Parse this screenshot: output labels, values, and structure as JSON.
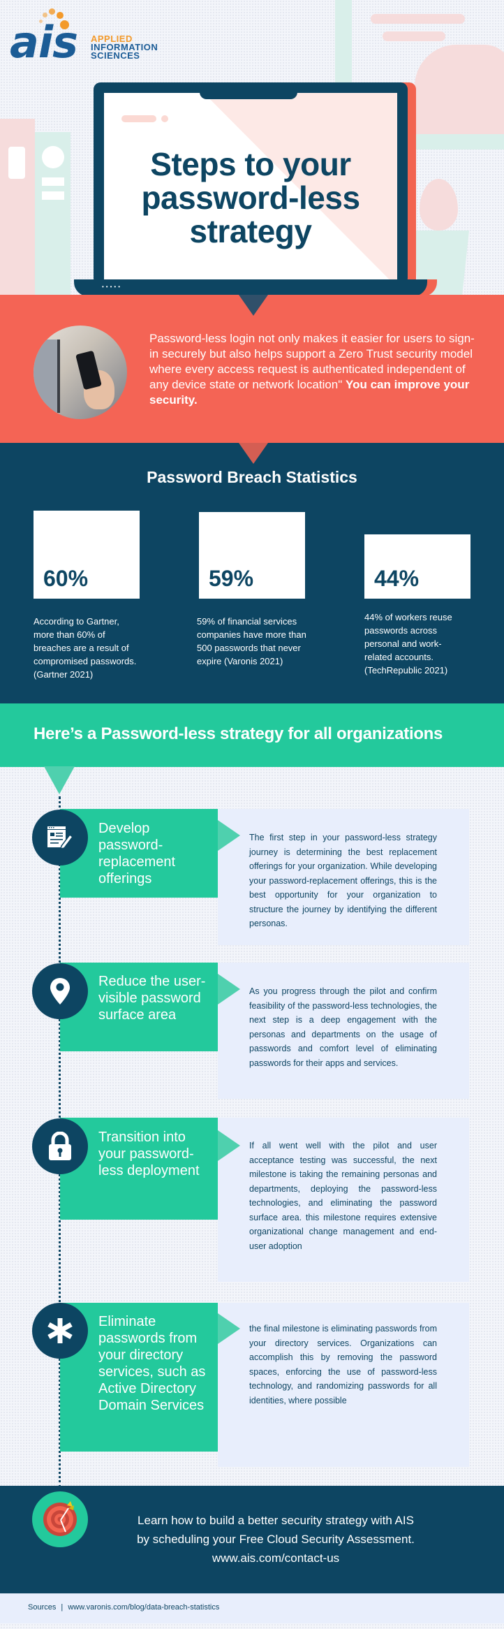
{
  "logo": {
    "mark": "ais",
    "line1": "APPLIED",
    "line2": "INFORMATION",
    "line3": "SCIENCES",
    "colors": {
      "orange": "#f39a2b",
      "blue": "#1b5c96"
    }
  },
  "hero": {
    "title_line1": "Steps to your",
    "title_line2": "password-less",
    "title_line3": "strategy",
    "laptop_leds": "•••••"
  },
  "intro": {
    "text": "Password-less login not only makes it easier for users to sign-in securely but also helps support a Zero Trust security model where every access request is authenticated independent of any device state or network location\"",
    "emphasis": "You can improve your security.",
    "photo": "person-holding-smartphone"
  },
  "stats": {
    "title": "Password Breach Statistics",
    "items": [
      {
        "value": "60%",
        "description": "According to Gartner, more than 60% of breaches are a result of compromised passwords. (Gartner  2021)"
      },
      {
        "value": "59%",
        "description": "59% of financial services companies have more than 500 passwords that never expire (Varonis 2021)"
      },
      {
        "value": "44%",
        "description": "44% of workers reuse passwords across personal and work-related accounts. (TechRepublic 2021)"
      }
    ]
  },
  "strategy": {
    "title": "Here’s a Password-less strategy for all organizations"
  },
  "steps": [
    {
      "icon": "document-edit-icon",
      "title": "Develop password-replacement offerings",
      "body": "The first step in your password-less strategy journey is determining the best replacement offerings for your organization. While developing your password-replacement offerings, this is the best opportunity for your organization to structure the journey by identifying the different personas."
    },
    {
      "icon": "location-pin-icon",
      "title": "Reduce the user-visible password surface area",
      "body": "As you progress through the pilot and confirm feasibility of the password-less technologies, the next step is a deep engagement with the personas and departments on the usage of passwords and comfort level of eliminating passwords for their apps and services."
    },
    {
      "icon": "padlock-icon",
      "title": "Transition into your password-less deployment",
      "body": "If all went well with the pilot and user acceptance testing was successful, the next milestone is taking the remaining personas and departments, deploying the password-less technologies, and eliminating the password surface area. this milestone requires extensive organizational change management and end-user adoption"
    },
    {
      "icon": "asterisk-icon",
      "title": "Eliminate passwords from your directory services, such as Active Directory Domain Services",
      "body": "the final milestone is eliminating passwords from your directory services. Organizations can accomplish this by removing the password spaces, enforcing the use of password-less technology, and randomizing passwords for all identities, where possible"
    }
  ],
  "cta": {
    "line1": "Learn how to build a better security strategy with AIS",
    "line2": "by scheduling your Free Cloud Security Assessment.",
    "link": "www.ais.com/contact-us",
    "icon": "target-arrow-icon"
  },
  "sources": {
    "label": "Sources",
    "separator": "|",
    "url": "www.varonis.com/blog/data-breach-statistics"
  },
  "colors": {
    "navy": "#0d4562",
    "coral": "#f46455",
    "green": "#23c99c",
    "panel": "#e8eefc"
  }
}
